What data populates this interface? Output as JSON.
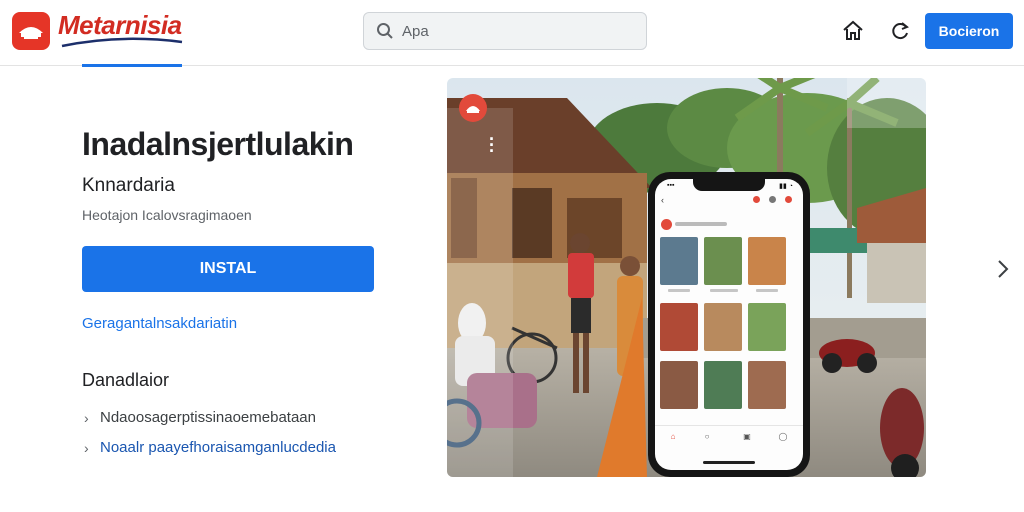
{
  "header": {
    "brand": "Metarnisia",
    "search_placeholder": "Apa",
    "signin_label": "Bocieron"
  },
  "app": {
    "title": "Inadalnsjertlulakin",
    "developer": "Knnardaria",
    "meta": "Heotajon Icalovsragimaoen",
    "install_label": "INSTAL",
    "share_link": "Geragantalnsakdariatin"
  },
  "about": {
    "title": "Danadlaior",
    "rows": [
      "Ndaoosagerptissinaoemebataan",
      "Noaalr paayefhoraisamganlucdedia"
    ]
  },
  "colors": {
    "accent": "#1a73e8",
    "brand": "#d22c22"
  },
  "icons": [
    "search-icon",
    "home-icon",
    "refresh-icon",
    "chevron-right-icon",
    "more-vert-icon"
  ]
}
